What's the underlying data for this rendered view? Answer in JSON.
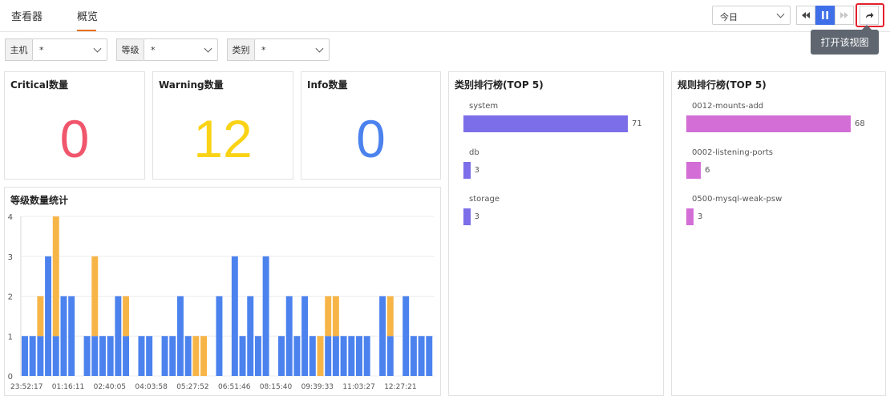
{
  "tabs": [
    {
      "label": "查看器",
      "active": false
    },
    {
      "label": "概览",
      "active": true
    }
  ],
  "time_range": {
    "value": "今日"
  },
  "controls": {
    "rewind_icon": "rewind-icon",
    "pause_icon": "pause-icon",
    "forward_icon": "fast-forward-icon",
    "open_view_icon": "share-arrow-icon"
  },
  "tooltip": {
    "text": "打开该视图"
  },
  "filters": [
    {
      "label": "主机",
      "value": "*"
    },
    {
      "label": "等级",
      "value": "*"
    },
    {
      "label": "类别",
      "value": "*"
    }
  ],
  "stats": [
    {
      "title": "Critical数量",
      "value": "0",
      "color": "#f0566c"
    },
    {
      "title": "Warning数量",
      "value": "12",
      "color": "#fad317"
    },
    {
      "title": "Info数量",
      "value": "0",
      "color": "#4b82ee"
    }
  ],
  "level_chart": {
    "title": "等级数量统计",
    "chart_data": {
      "type": "bar",
      "stacked": true,
      "ylim": [
        0,
        4
      ],
      "yticks": [
        "0",
        "1",
        "2",
        "3",
        "4"
      ],
      "xticks": [
        "23:52:17",
        "01:16:11",
        "02:40:05",
        "04:03:58",
        "05:27:52",
        "06:51:46",
        "08:15:40",
        "09:39:33",
        "11:03:27",
        "12:27:21"
      ],
      "series": [
        {
          "color": "#4b82ee",
          "values": [
            1,
            1,
            1,
            3,
            1,
            2,
            2,
            0,
            1,
            1,
            1,
            1,
            2,
            1,
            0,
            1,
            1,
            0,
            1,
            1,
            2,
            1,
            0,
            0,
            0,
            2,
            0,
            3,
            1,
            2,
            1,
            3,
            0,
            1,
            2,
            1,
            2,
            1,
            0,
            1,
            1,
            1,
            1,
            1,
            1,
            0,
            2,
            1,
            0,
            2,
            1,
            1,
            1
          ]
        },
        {
          "color": "#f7b547",
          "values": [
            0,
            0,
            1,
            0,
            3,
            0,
            0,
            0,
            0,
            2,
            0,
            0,
            0,
            1,
            0,
            0,
            0,
            0,
            0,
            0,
            0,
            0,
            1,
            1,
            0,
            0,
            0,
            0,
            0,
            0,
            0,
            0,
            0,
            0,
            0,
            0,
            0,
            0,
            1,
            1,
            1,
            0,
            0,
            0,
            0,
            0,
            0,
            1,
            0,
            0,
            0,
            0,
            0
          ]
        }
      ]
    }
  },
  "category_rank": {
    "title": "类别排行榜(TOP 5)",
    "color": "#7b6ee8",
    "chart_data": {
      "type": "bar",
      "orientation": "horizontal",
      "categories": [
        "system",
        "db",
        "storage"
      ],
      "values": [
        71,
        3,
        3
      ]
    },
    "items": [
      {
        "label": "system",
        "value": "71"
      },
      {
        "label": "db",
        "value": "3"
      },
      {
        "label": "storage",
        "value": "3"
      }
    ]
  },
  "rule_rank": {
    "title": "规则排行榜(TOP 5)",
    "color": "#d46ed7",
    "chart_data": {
      "type": "bar",
      "orientation": "horizontal",
      "categories": [
        "0012-mounts-add",
        "0002-listening-ports",
        "0500-mysql-weak-psw"
      ],
      "values": [
        68,
        6,
        3
      ]
    },
    "items": [
      {
        "label": "0012-mounts-add",
        "value": "68"
      },
      {
        "label": "0002-listening-ports",
        "value": "6"
      },
      {
        "label": "0500-mysql-weak-psw",
        "value": "3"
      }
    ]
  }
}
